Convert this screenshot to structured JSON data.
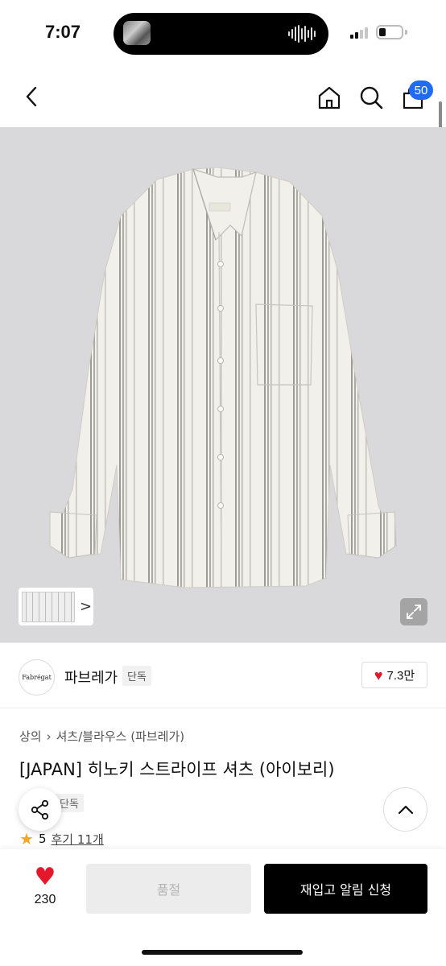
{
  "status_bar": {
    "time": "7:07"
  },
  "nav": {
    "cart_count": "50",
    "icons": [
      "chevron-left-icon",
      "home-icon",
      "search-icon",
      "shopping-bag-icon"
    ]
  },
  "colors": {
    "accent_blue": "#1f6cf2",
    "heart_red": "#e4172b",
    "star_orange": "#f5a623",
    "hero_bg": "#d9d9db"
  },
  "gallery": {
    "thumb_arrow": ">"
  },
  "brand": {
    "logo_text": "Fabrégat",
    "name": "파브레가",
    "tag": "단독",
    "likes": "7.3만"
  },
  "product": {
    "breadcrumb": [
      "상의",
      "셔츠/블라우스 (파브레가)"
    ],
    "title": "[JAPAN] 히노키 스트라이프 셔츠 (아이보리)",
    "tag": "단독",
    "rating": "5",
    "review_label": "후기 11개"
  },
  "bottom_bar": {
    "wish_count": "230",
    "soldout_label": "품절",
    "restock_label": "재입고 알림 신청"
  }
}
